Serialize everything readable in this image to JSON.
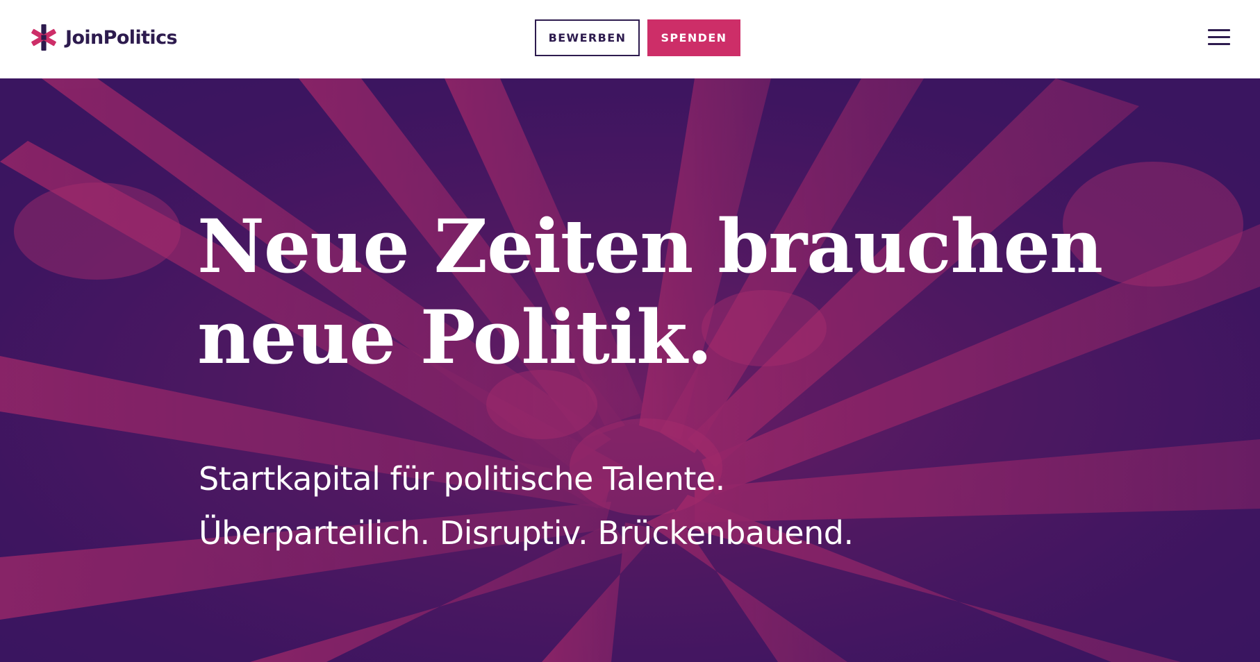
{
  "header": {
    "logo_text": "JoinPolitics",
    "apply_label": "BEWERBEN",
    "donate_label": "SPENDEN"
  },
  "hero": {
    "title_line1": "Neue Zeiten brauchen",
    "title_line2": "neue Politik.",
    "subtitle_line1": "Startkapital für politische Talente.",
    "subtitle_line2": "Überparteilich. Disruptiv. Brückenbauend."
  },
  "icons": {
    "logo": "asterisk-logo-icon",
    "menu": "hamburger-menu-icon"
  },
  "colors": {
    "brand_dark": "#2d1b4e",
    "brand_accent": "#cd2e68",
    "hero_overlay_dark": "#3b1560",
    "hero_overlay_light": "#c6306d"
  }
}
